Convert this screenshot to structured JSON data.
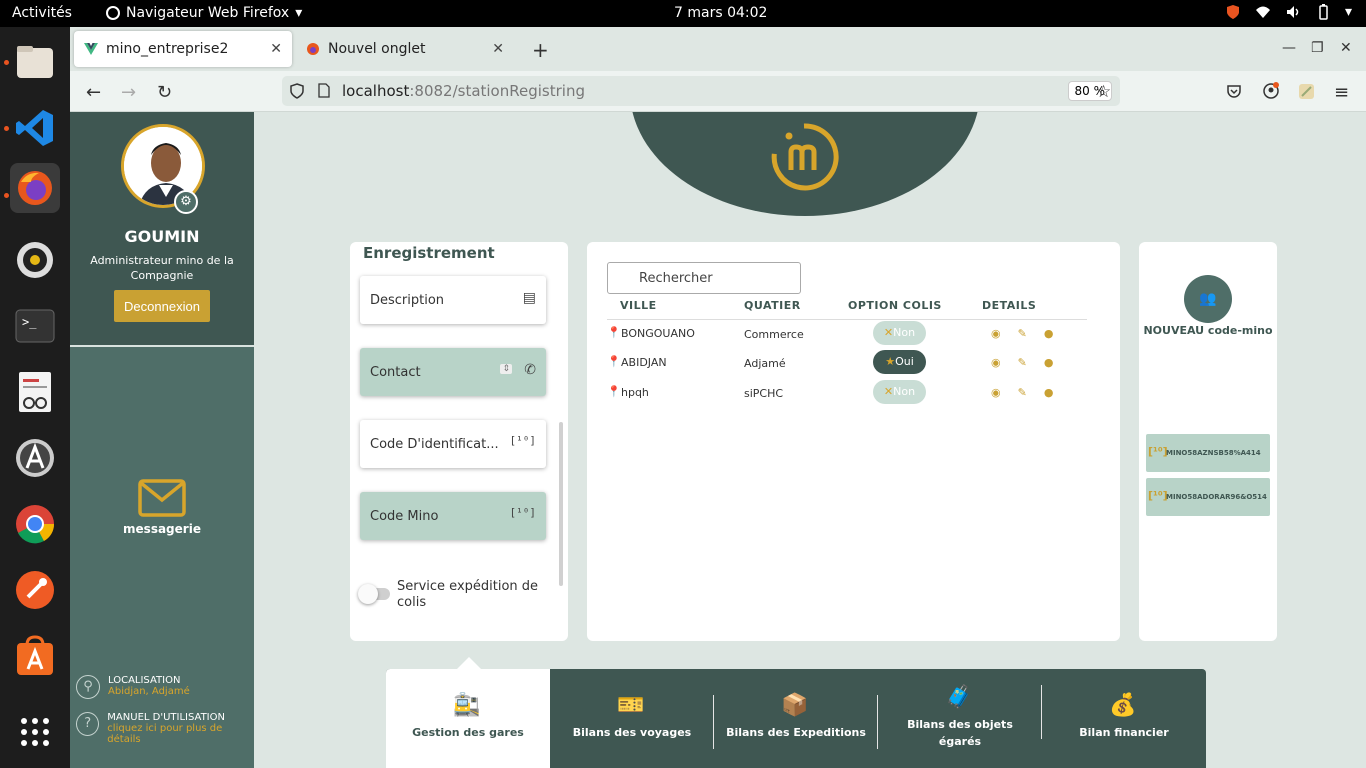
{
  "topbar": {
    "activities": "Activités",
    "app": "Navigateur Web Firefox",
    "clock": "7 mars  04:02"
  },
  "browser": {
    "tabs": [
      {
        "label": "mino_entreprise2"
      },
      {
        "label": "Nouvel onglet"
      }
    ],
    "url_host": "localhost",
    "url_rest": ":8082/stationRegistring",
    "zoom": "80 %"
  },
  "sidebar": {
    "name": "GOUMIN",
    "role": "Administrateur mino de la Compagnie",
    "logout": "Deconnexion",
    "messagerie": "messagerie",
    "localisation_title": "LOCALISATION",
    "localisation_value": "Abidjan, Adjamé",
    "manuel_title": "MANUEL D'UTILISATION",
    "manuel_value": "cliquez ici pour plus de détails"
  },
  "registration": {
    "title": "Enregistrement",
    "fields": [
      "Description",
      "Contact",
      "Code D'identificat...",
      "Code Mino"
    ],
    "service_label": "Service expédition de colis"
  },
  "table": {
    "search_placeholder": "Rechercher",
    "headers": [
      "VILLE",
      "QUATIER",
      "OPTION COLIS",
      "DETAILS"
    ],
    "rows": [
      {
        "ville": "BONGOUANO",
        "quartier": "Commerce",
        "option": "Non"
      },
      {
        "ville": "ABIDJAN",
        "quartier": "Adjamé",
        "option": "Oui"
      },
      {
        "ville": "hpqh",
        "quartier": "siPCHC",
        "option": "Non"
      }
    ]
  },
  "codes": {
    "title": "NOUVEAU code-mino",
    "items": [
      "MINO58AZNSB58%A414",
      "MINO58ADORAR96&O514"
    ]
  },
  "bottom_nav": [
    "Gestion des gares",
    "Bilans des voyages",
    "Bilans des Expeditions",
    "Bilans des objets égarés",
    "Bilan financier"
  ],
  "colors": {
    "dark_green": "#3f5752",
    "gold": "#c9a133",
    "light_green": "#b8d3c8"
  }
}
